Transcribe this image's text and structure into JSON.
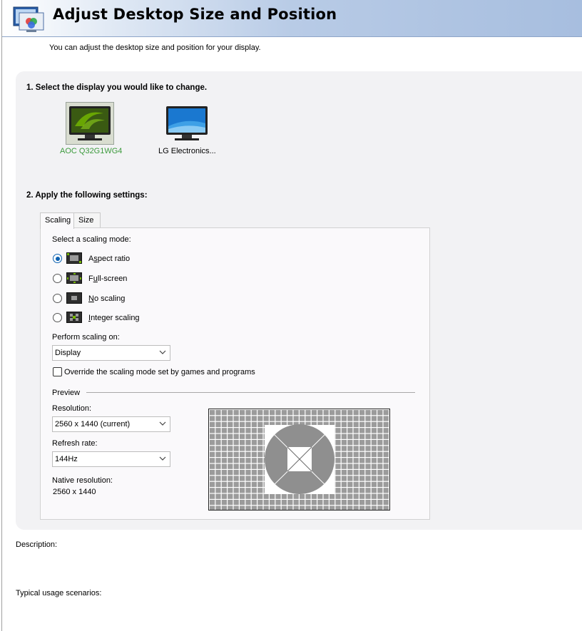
{
  "header": {
    "title": "Adjust Desktop Size and Position",
    "subtitle": "You can adjust the desktop size and position for your display."
  },
  "step1": {
    "title": "1. Select the display you would like to change.",
    "displays": [
      {
        "label": "AOC Q32G1WG4",
        "selected": true,
        "label_color": "#3c9a3c"
      },
      {
        "label": "LG Electronics...",
        "selected": false
      }
    ]
  },
  "step2": {
    "title": "2. Apply the following settings:",
    "tabs": [
      {
        "label": "Scaling",
        "active": true
      },
      {
        "label": "Size",
        "active": false
      }
    ],
    "scaling_mode_label": "Select a scaling mode:",
    "modes": [
      {
        "label": "Aspect ratio",
        "mnemonic": "s",
        "checked": true
      },
      {
        "label": "Full-screen",
        "mnemonic": "u",
        "checked": false
      },
      {
        "label": "No scaling",
        "mnemonic": "N",
        "checked": false
      },
      {
        "label": "Integer scaling",
        "mnemonic": "I",
        "checked": false
      }
    ],
    "perform_scaling_label": "Perform scaling on:",
    "perform_scaling_value": "Display",
    "override_label": "Override the scaling mode set by games and programs",
    "override_checked": false,
    "preview_label": "Preview",
    "resolution_label": "Resolution:",
    "resolution_value": "2560 x 1440 (current)",
    "refresh_label": "Refresh rate:",
    "refresh_value": "144Hz",
    "native_label": "Native resolution:",
    "native_value": "2560 x 1440"
  },
  "footer": {
    "description_label": "Description:",
    "usage_label": "Typical usage scenarios:"
  },
  "colors": {
    "accent": "#0a5fb0",
    "header_gradient_end": "#a7bedf",
    "nvidia_green": "#76b900"
  }
}
